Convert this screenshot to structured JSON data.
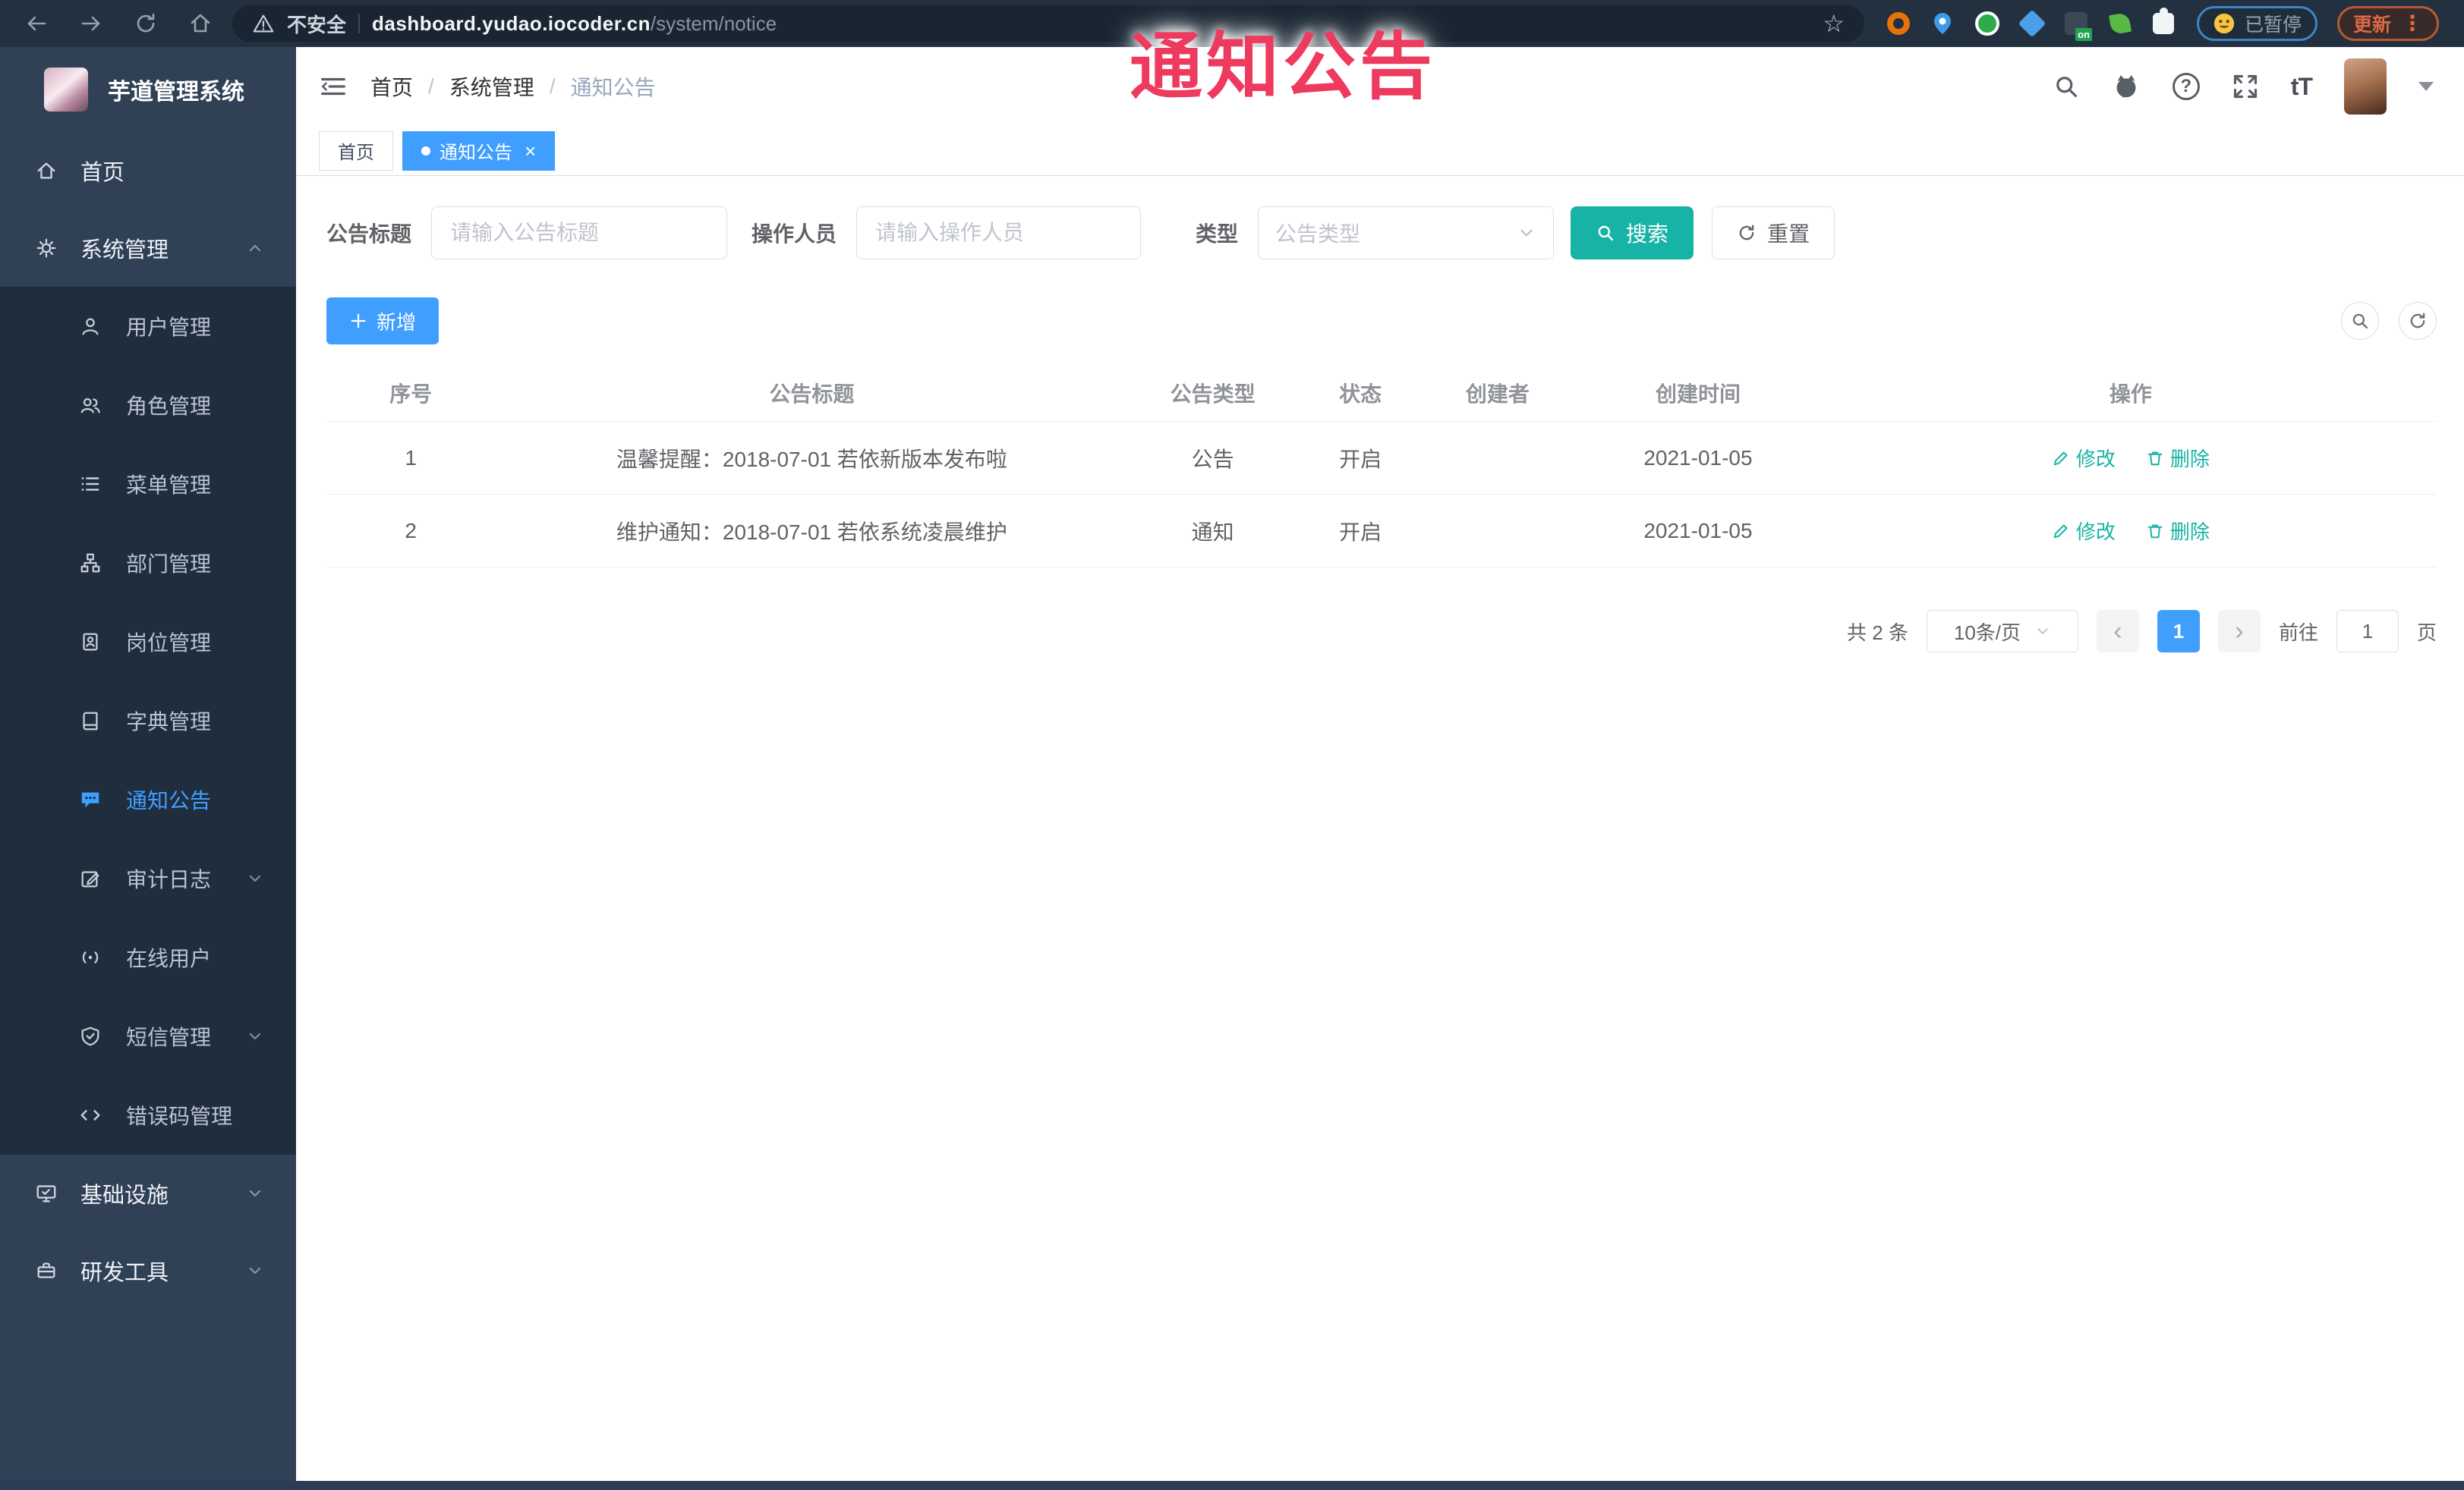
{
  "overlay": {
    "title": "通知公告"
  },
  "browser": {
    "security_label": "不安全",
    "url_host": "dashboard.yudao.iocoder.cn",
    "url_path": "/system/notice",
    "extension_on_badge": "on",
    "paused_label": "已暂停",
    "update_label": "更新"
  },
  "glyphs": {
    "separator": "/",
    "close": "×",
    "star": "☆",
    "dots": "⋮",
    "question": "?",
    "font_size": "tT",
    "prev": "‹",
    "next": "›"
  },
  "sidebar": {
    "app_title": "芋道管理系统",
    "home_label": "首页",
    "system_label": "系统管理",
    "sub": [
      {
        "label": "用户管理"
      },
      {
        "label": "角色管理"
      },
      {
        "label": "菜单管理"
      },
      {
        "label": "部门管理"
      },
      {
        "label": "岗位管理"
      },
      {
        "label": "字典管理"
      },
      {
        "label": "通知公告"
      },
      {
        "label": "审计日志"
      },
      {
        "label": "在线用户"
      },
      {
        "label": "短信管理"
      },
      {
        "label": "错误码管理"
      }
    ],
    "infra_label": "基础设施",
    "devtools_label": "研发工具"
  },
  "navbar": {
    "breadcrumb": [
      "首页",
      "系统管理",
      "通知公告"
    ]
  },
  "tabs": [
    {
      "label": "首页"
    },
    {
      "label": "通知公告"
    }
  ],
  "filters": {
    "title_label": "公告标题",
    "title_placeholder": "请输入公告标题",
    "operator_label": "操作人员",
    "operator_placeholder": "请输入操作人员",
    "type_label": "类型",
    "type_placeholder": "公告类型",
    "search_label": "搜索",
    "reset_label": "重置"
  },
  "toolbar": {
    "add_label": "新增"
  },
  "table": {
    "columns": [
      "序号",
      "公告标题",
      "公告类型",
      "状态",
      "创建者",
      "创建时间",
      "操作"
    ],
    "rows": [
      {
        "no": "1",
        "title": "温馨提醒：2018-07-01 若依新版本发布啦",
        "type": "公告",
        "status": "开启",
        "creator": "",
        "time": "2021-01-05"
      },
      {
        "no": "2",
        "title": "维护通知：2018-07-01 若依系统凌晨维护",
        "type": "通知",
        "status": "开启",
        "creator": "",
        "time": "2021-01-05"
      }
    ]
  },
  "row_actions": {
    "edit": "修改",
    "delete": "删除"
  },
  "pagination": {
    "total": "共 2 条",
    "size": "10条/页",
    "page": "1",
    "goto_label": "前往",
    "goto_value": "1",
    "unit_label": "页"
  },
  "colors": {
    "accent": "#409EFF",
    "search_teal": "#17b3a6",
    "sidebar_bg": "#304156",
    "submenu_bg": "#1f2d3d",
    "overlay_red": "#ed3a5e",
    "chrome_bg": "#22303f"
  }
}
